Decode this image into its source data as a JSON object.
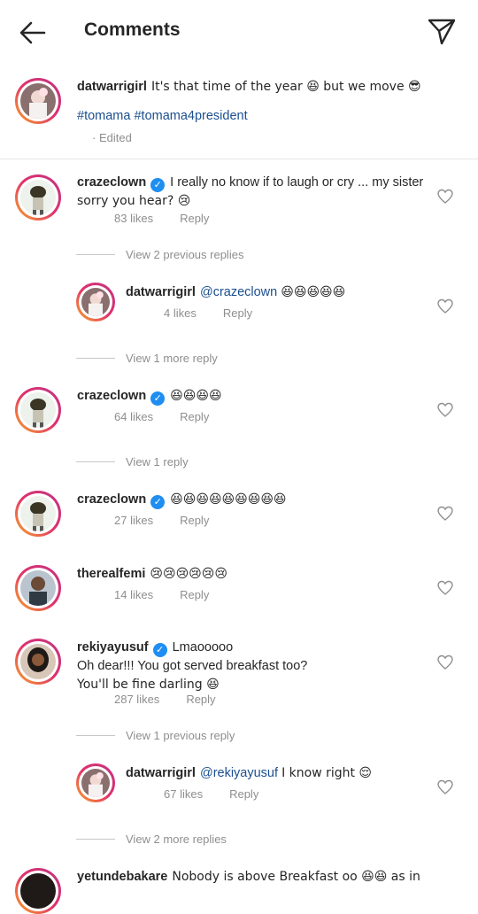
{
  "header": {
    "title": "Comments"
  },
  "caption": {
    "username": "datwarrigirl",
    "text": "It's that time of the year 😆 but we move 😎",
    "hashtags": "#tomama #tomama4president",
    "edited": "· Edited"
  },
  "comments": [
    {
      "username": "crazeclown",
      "verified": true,
      "text_line1": "I really no know if to laugh or cry ... my sister",
      "text_line2": "sorry you hear? 😢",
      "likes": "83 likes",
      "reply": "Reply",
      "thread": "View 2 previous replies"
    },
    {
      "username": "datwarrigirl",
      "mention": "@crazeclown",
      "text": "😆😆😆😆😆",
      "likes": "4 likes",
      "reply": "Reply",
      "thread": "View 1 more reply"
    },
    {
      "username": "crazeclown",
      "verified": true,
      "text": "😆😆😆😆",
      "likes": "64 likes",
      "reply": "Reply",
      "thread": "View 1 reply"
    },
    {
      "username": "crazeclown",
      "verified": true,
      "text": "😆😆😆😆😆😆😆😆😆",
      "likes": "27 likes",
      "reply": "Reply"
    },
    {
      "username": "therealfemi",
      "text": "😢😢😢😢😢😢",
      "likes": "14 likes",
      "reply": "Reply"
    },
    {
      "username": "rekiyayusuf",
      "verified": true,
      "text_line1": "Lmaooooo",
      "text_line2": "Oh dear!!! You got served breakfast too?",
      "text_line3": "You'll be fine darling 😆",
      "likes": "287 likes",
      "reply": "Reply",
      "thread": "View 1 previous reply"
    },
    {
      "username": "datwarrigirl",
      "mention": "@rekiyayusuf",
      "text": "I know right 😌",
      "likes": "67 likes",
      "reply": "Reply",
      "thread": "View 2 more replies"
    },
    {
      "username": "yetundebakare",
      "text": "Nobody is above Breakfast oo 😆😆 as in"
    }
  ],
  "colors": {
    "text": "#262626",
    "muted": "#8e8e8e",
    "link": "#1b4f8f",
    "verified": "#1f8ef1"
  }
}
